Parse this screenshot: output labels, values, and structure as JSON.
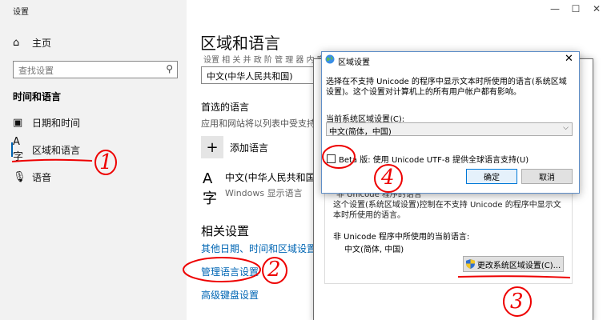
{
  "window": {
    "title": "设置",
    "controls": [
      "—",
      "☐",
      "✕"
    ]
  },
  "sidebar": {
    "home_label": "主页",
    "search_placeholder": "查找设置",
    "section_header": "时间和语言",
    "items": [
      {
        "label": "日期和时间",
        "icon": "calendar-clock-icon"
      },
      {
        "label": "区域和语言",
        "icon": "language-icon"
      },
      {
        "label": "语音",
        "icon": "microphone-icon"
      }
    ]
  },
  "main": {
    "title": "区域和语言",
    "partial_text": "设置 相 关 并 政 阶 管 理 器 内 容",
    "country_value": "中文(中华人民共和国)",
    "preferred_heading": "首选的语言",
    "preferred_desc": "应用和网站将以列表中受支持",
    "add_language_label": "添加语言",
    "language": {
      "name": "中文(中华人民共和国)",
      "sub": "Windows 显示语言"
    },
    "related_heading": "相关设置",
    "links": [
      "其他日期、时间和区域设置",
      "管理语言设置",
      "高级键盘设置"
    ]
  },
  "region_dialog": {
    "group_label": "非 Unicode 程序的语言",
    "panel_desc": "这个设置(系统区域设置)控制在不支持 Unicode 的程序中显示文本时所使用的语言。",
    "current_label": "非 Unicode 程序中所使用的当前语言:",
    "current_value": "中文(简体, 中国)",
    "change_button": "更改系统区域设置(C)..."
  },
  "fg_dialog": {
    "title": "区域设置",
    "close": "✕",
    "desc": "选择在不支持 Unicode 的程序中显示文本时所使用的语言(系统区域设置)。这个设置对计算机上的所有用户帐户都有影响。",
    "locale_label": "当前系统区域设置(C):",
    "locale_value": "中文(简体，中国)",
    "beta_label": "Beta 版: 使用 Unicode UTF-8 提供全球语言支持(U)",
    "ok": "确定",
    "cancel": "取消"
  },
  "annotations": [
    "1",
    "2",
    "3",
    "4"
  ],
  "colors": {
    "accent": "#0063b1",
    "link": "#0066b4",
    "annotation": "#ee0000"
  }
}
